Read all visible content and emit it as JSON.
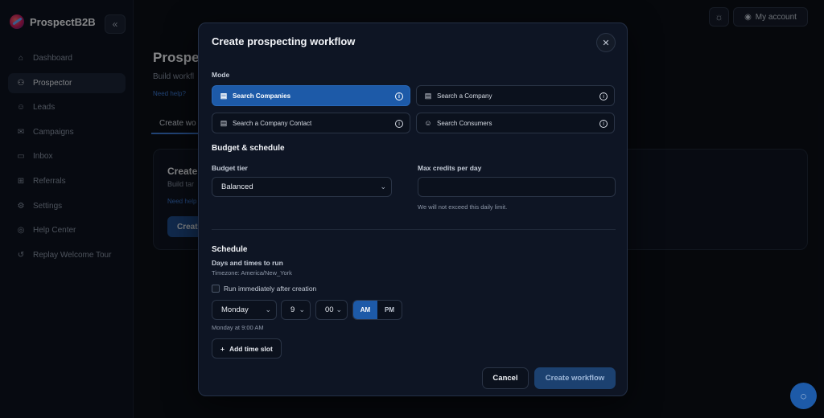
{
  "app": {
    "name": "ProspectB2B"
  },
  "header": {
    "account_label": "My account"
  },
  "sidebar": {
    "items": [
      {
        "label": "Dashboard",
        "icon": "home-icon"
      },
      {
        "label": "Prospector",
        "icon": "users-icon",
        "active": true
      },
      {
        "label": "Leads",
        "icon": "person-icon"
      },
      {
        "label": "Campaigns",
        "icon": "mail-icon"
      },
      {
        "label": "Inbox",
        "icon": "inbox-icon"
      },
      {
        "label": "Referrals",
        "icon": "gift-icon"
      },
      {
        "label": "Settings",
        "icon": "gear-icon"
      },
      {
        "label": "Help Center",
        "icon": "help-icon"
      },
      {
        "label": "Replay Welcome Tour",
        "icon": "replay-icon"
      }
    ]
  },
  "background": {
    "title": "Prospe",
    "subtitle": "Build workfl",
    "help": "Need help?",
    "tab": "Create wo",
    "card_title": "Create",
    "card_sub": "Build tar",
    "card_help": "Need help",
    "card_button": "Creat"
  },
  "modal": {
    "title": "Create prospecting workflow",
    "mode_label": "Mode",
    "modes": [
      {
        "label": "Search Companies",
        "active": true
      },
      {
        "label": "Search a Company",
        "active": false
      },
      {
        "label": "Search a Company Contact",
        "active": false
      },
      {
        "label": "Search Consumers",
        "active": false
      }
    ],
    "budget_section": "Budget & schedule",
    "budget_tier_label": "Budget tier",
    "budget_tier_value": "Balanced",
    "max_credits_label": "Max credits per day",
    "max_credits_value": "",
    "max_credits_hint": "We will not exceed this daily limit.",
    "schedule_section": "Schedule",
    "days_label": "Days and times to run",
    "timezone": "Timezone: America/New_York",
    "run_immediately_label": "Run immediately after creation",
    "day_value": "Monday",
    "hour_value": "9",
    "minute_value": "00",
    "am_label": "AM",
    "pm_label": "PM",
    "schedule_summary": "Monday at 9:00 AM",
    "add_slot_label": "Add time slot",
    "cancel_label": "Cancel",
    "create_label": "Create workflow"
  }
}
